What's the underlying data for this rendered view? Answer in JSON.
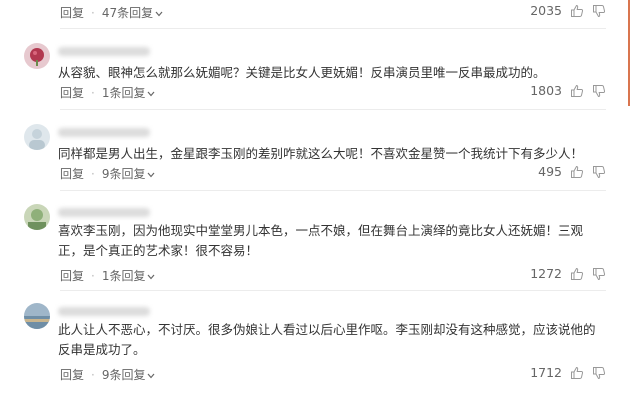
{
  "colors": {
    "accent_border": "#d9754f",
    "text": "#333333",
    "meta": "#666666"
  },
  "icons": {
    "like": "thumb-up-icon",
    "dislike": "thumb-down-icon",
    "expand": "chevron-down-icon"
  },
  "comments": [
    {
      "text": "",
      "reply_label": "回复",
      "replies_label": "47条回复",
      "likes": "2035"
    },
    {
      "text": "从容貌、眼神怎么就那么妩媚呢？关键是比女人更妩媚！反串演员里唯一反串最成功的。",
      "reply_label": "回复",
      "replies_label": "1条回复",
      "likes": "1803"
    },
    {
      "text": "同样都是男人出生，金星跟李玉刚的差别咋就这么大呢！不喜欢金星赞一个我统计下有多少人！",
      "reply_label": "回复",
      "replies_label": "9条回复",
      "likes": "495"
    },
    {
      "text": "喜欢李玉刚，因为他现实中堂堂男儿本色，一点不娘，但在舞台上演绎的竟比女人还妩媚！三观正，是个真正的艺术家！很不容易！",
      "reply_label": "回复",
      "replies_label": "1条回复",
      "likes": "1272"
    },
    {
      "text": "此人让人不恶心，不讨厌。很多伪娘让人看过以后心里作呕。李玉刚却没有这种感觉，应该说他的反串是成功了。",
      "reply_label": "回复",
      "replies_label": "9条回复",
      "likes": "1712"
    }
  ]
}
